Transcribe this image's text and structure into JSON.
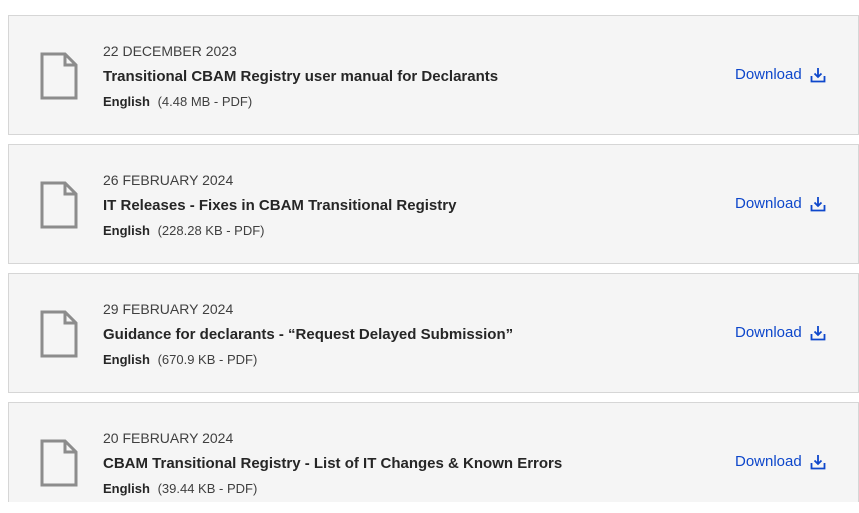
{
  "documents": [
    {
      "date": "22 DECEMBER 2023",
      "title": "Transitional CBAM Registry user manual for Declarants",
      "language": "English",
      "details": "(4.48 MB - PDF)",
      "download_label": "Download",
      "icon": "file-icon"
    },
    {
      "date": "26 FEBRUARY 2024",
      "title": "IT Releases - Fixes in CBAM Transitional Registry",
      "language": "English",
      "details": "(228.28 KB - PDF)",
      "download_label": "Download",
      "icon": "file-icon"
    },
    {
      "date": "29 FEBRUARY 2024",
      "title": "Guidance for declarants - “Request Delayed Submission”",
      "language": "English",
      "details": "(670.9 KB - PDF)",
      "download_label": "Download",
      "icon": "file-icon"
    },
    {
      "date": "20 FEBRUARY 2024",
      "title": "CBAM Transitional Registry - List of IT Changes & Known Errors",
      "language": "English",
      "details": "(39.44 KB - PDF)",
      "download_label": "Download",
      "icon": "file-icon"
    }
  ],
  "colors": {
    "link": "#0e47cb",
    "card_background": "#f5f5f5",
    "card_border": "#d6d6d6",
    "icon_stroke": "#8c8c8c"
  },
  "icons": {
    "download": "download-icon",
    "file": "file-icon"
  }
}
